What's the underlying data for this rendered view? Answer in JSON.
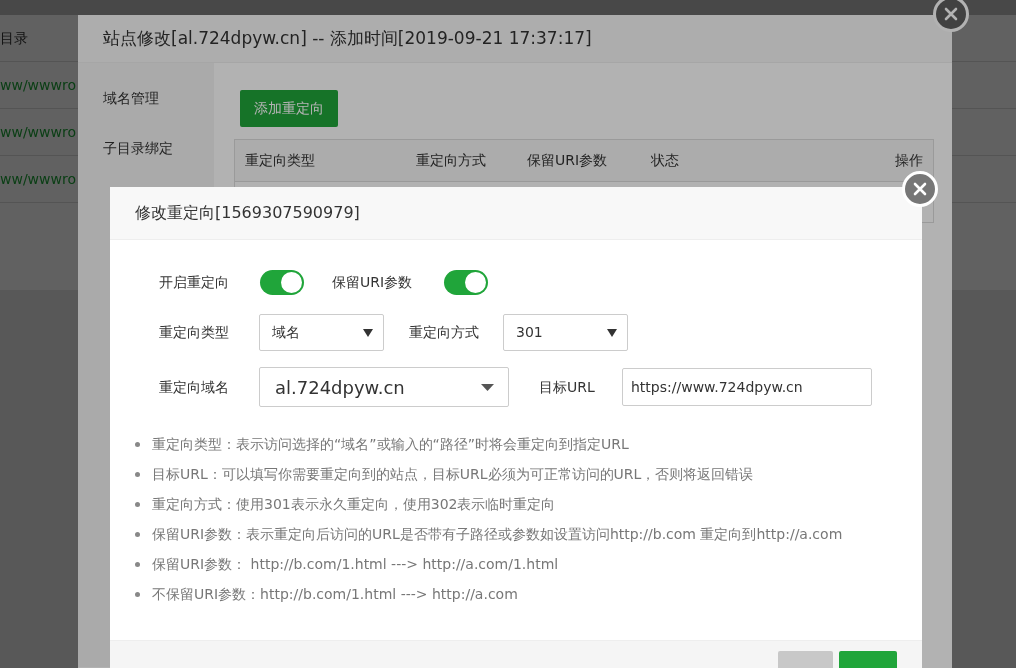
{
  "background_page": {
    "header_text": "目录",
    "rows": [
      "ww/wwwro",
      "ww/wwwro",
      "ww/wwwro"
    ]
  },
  "site_dialog": {
    "title": "站点修改[al.724dpyw.cn] -- 添加时间[2019-09-21 17:37:17]",
    "sidebar": {
      "items": [
        "域名管理",
        "子目录绑定"
      ]
    },
    "add_button": "添加重定向",
    "table": {
      "columns": [
        "重定向类型",
        "重定向方式",
        "保留URI参数",
        "状态",
        "操作"
      ]
    }
  },
  "redirect_dialog": {
    "title": "修改重定向[1569307590979]",
    "toggles": [
      {
        "label": "开启重定向",
        "on": true
      },
      {
        "label": "保留URI参数",
        "on": true
      }
    ],
    "fields": [
      {
        "label": "重定向类型",
        "kind": "select",
        "value": "域名"
      },
      {
        "label": "重定向方式",
        "kind": "select",
        "value": "301"
      },
      {
        "label": "重定向域名",
        "kind": "combo",
        "value": "al.724dpyw.cn"
      },
      {
        "label": "目标URL",
        "kind": "input",
        "value": "https://www.724dpyw.cn"
      }
    ],
    "notes": [
      "重定向类型：表示访问选择的“域名”或输入的“路径”时将会重定向到指定URL",
      "目标URL：可以填写你需要重定向到的站点，目标URL必须为可正常访问的URL，否则将返回错误",
      "重定向方式：使用301表示永久重定向，使用302表示临时重定向",
      "保留URI参数：表示重定向后访问的URL是否带有子路径或参数如设置访问http://b.com 重定向到http://a.com",
      "保留URI参数： http://b.com/1.html ---> http://a.com/1.html",
      "不保留URI参数：http://b.com/1.html ---> http://a.com"
    ],
    "footer_buttons": [
      {
        "kind": "secondary"
      },
      {
        "kind": "primary"
      }
    ]
  }
}
